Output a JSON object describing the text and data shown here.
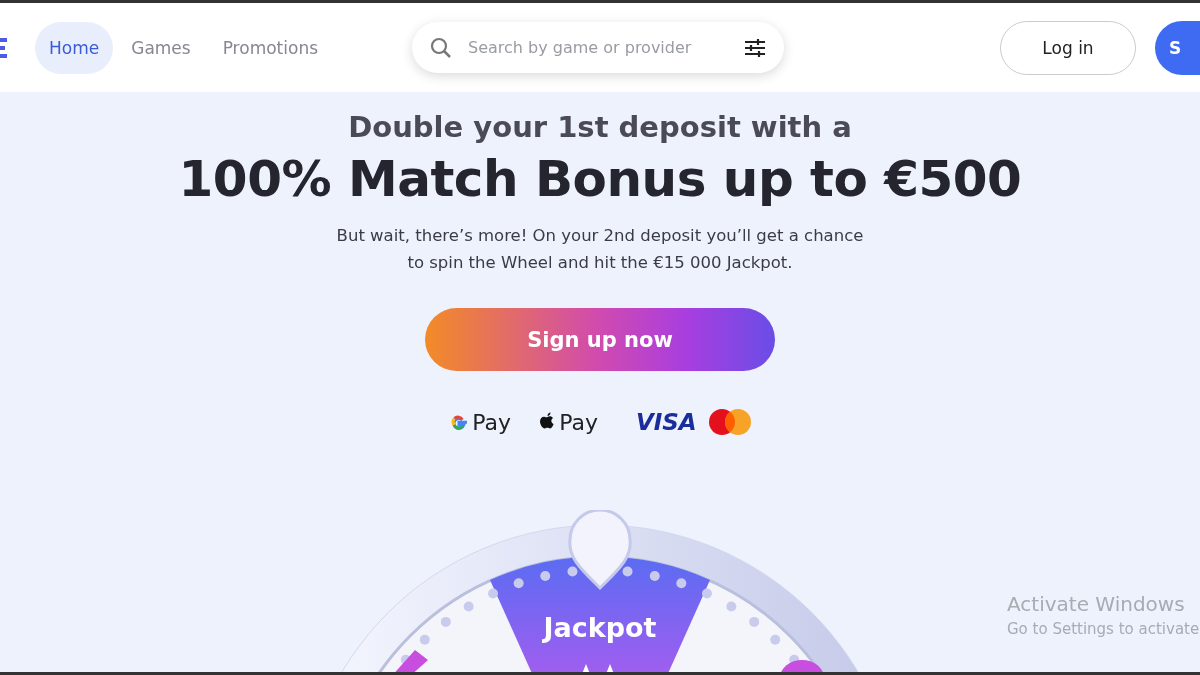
{
  "nav": {
    "items": [
      {
        "label": "Home",
        "selected": true
      },
      {
        "label": "Games",
        "selected": false
      },
      {
        "label": "Promotions",
        "selected": false
      }
    ]
  },
  "search": {
    "placeholder": "Search by game or provider"
  },
  "header_buttons": [
    {
      "label": "Log in",
      "kind": "outline"
    },
    {
      "label": "S",
      "kind": "primary"
    }
  ],
  "hero": {
    "kicker": "Double your 1st deposit with a",
    "headline": "100% Match Bonus up to €500",
    "text": "But wait, there’s more! On your 2nd deposit you’ll get a chance to spin the Wheel and hit the €15 000 Jackpot.",
    "cta": "Sign up now"
  },
  "payments": [
    {
      "label": "Pay",
      "kind": "gpay"
    },
    {
      "label": "Pay",
      "kind": "applepay"
    },
    {
      "label": "VISA",
      "kind": "visa"
    },
    {
      "kind": "mastercard"
    }
  ],
  "wheel": {
    "segment_label": "Jackpot"
  },
  "os_notice": {
    "title": "Activate Windows",
    "text": "Go to Settings to activate"
  }
}
